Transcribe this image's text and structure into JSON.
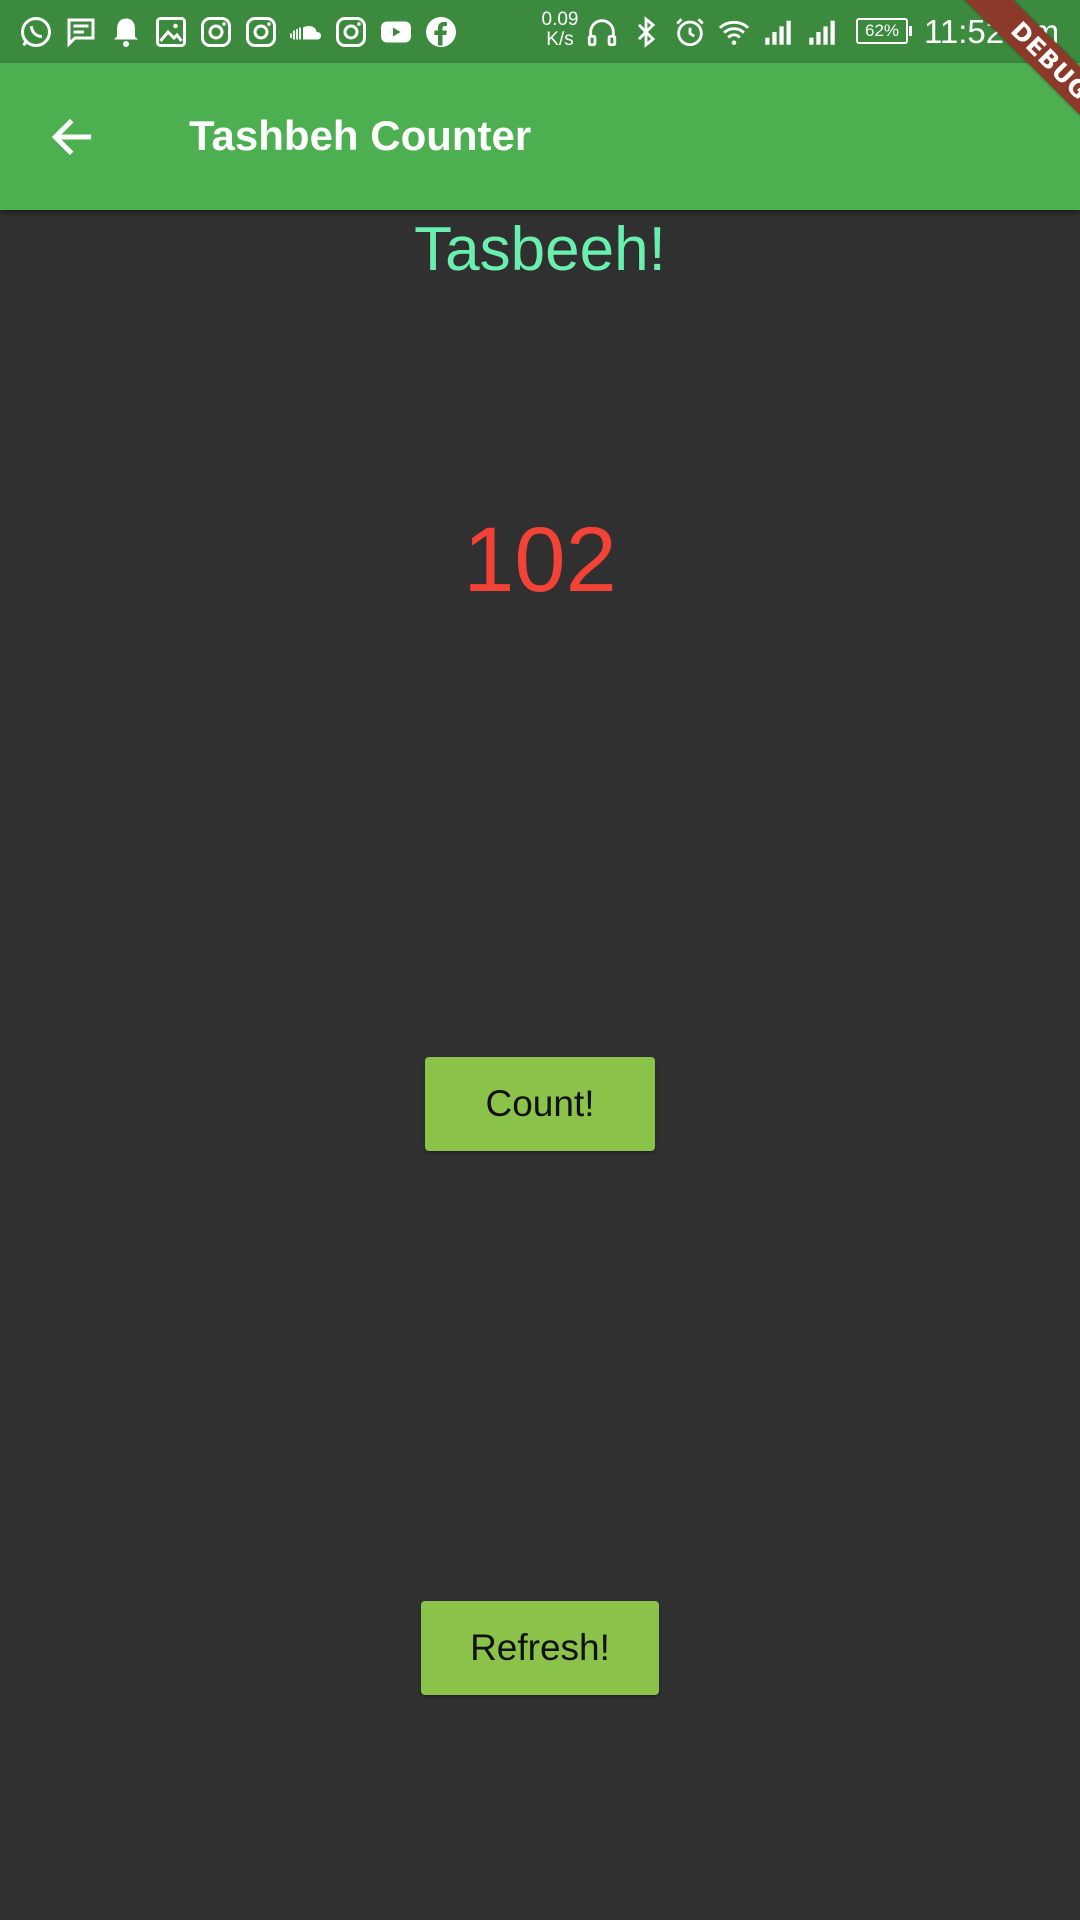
{
  "status_bar": {
    "left_icons": [
      "whatsapp-icon",
      "message-icon",
      "bell-icon",
      "gallery-icon",
      "instagram-icon",
      "instagram-icon",
      "soundcloud-icon",
      "instagram-icon",
      "youtube-icon",
      "facebook-icon"
    ],
    "net_speed_value": "0.09",
    "net_speed_unit": "K/s",
    "right_icons": [
      "headphones-icon",
      "bluetooth-icon",
      "alarm-icon",
      "wifi-icon",
      "signal-icon",
      "signal-icon"
    ],
    "battery": "62%",
    "time": "11:52 pm"
  },
  "app_bar": {
    "back_icon": "arrow-back-icon",
    "title": "Tashbeh Counter"
  },
  "debug_banner": "DEBUG",
  "main": {
    "heading": "Tasbeeh!",
    "counter_value": "102",
    "count_button_label": "Count!",
    "refresh_button_label": "Refresh!"
  },
  "colors": {
    "status_bar": "#3b8a3e",
    "app_bar": "#4caf50",
    "background": "#303030",
    "heading": "#69f0ae",
    "counter": "#f44336",
    "button": "#8bc34a",
    "debug_banner": "#8b3a2a"
  }
}
